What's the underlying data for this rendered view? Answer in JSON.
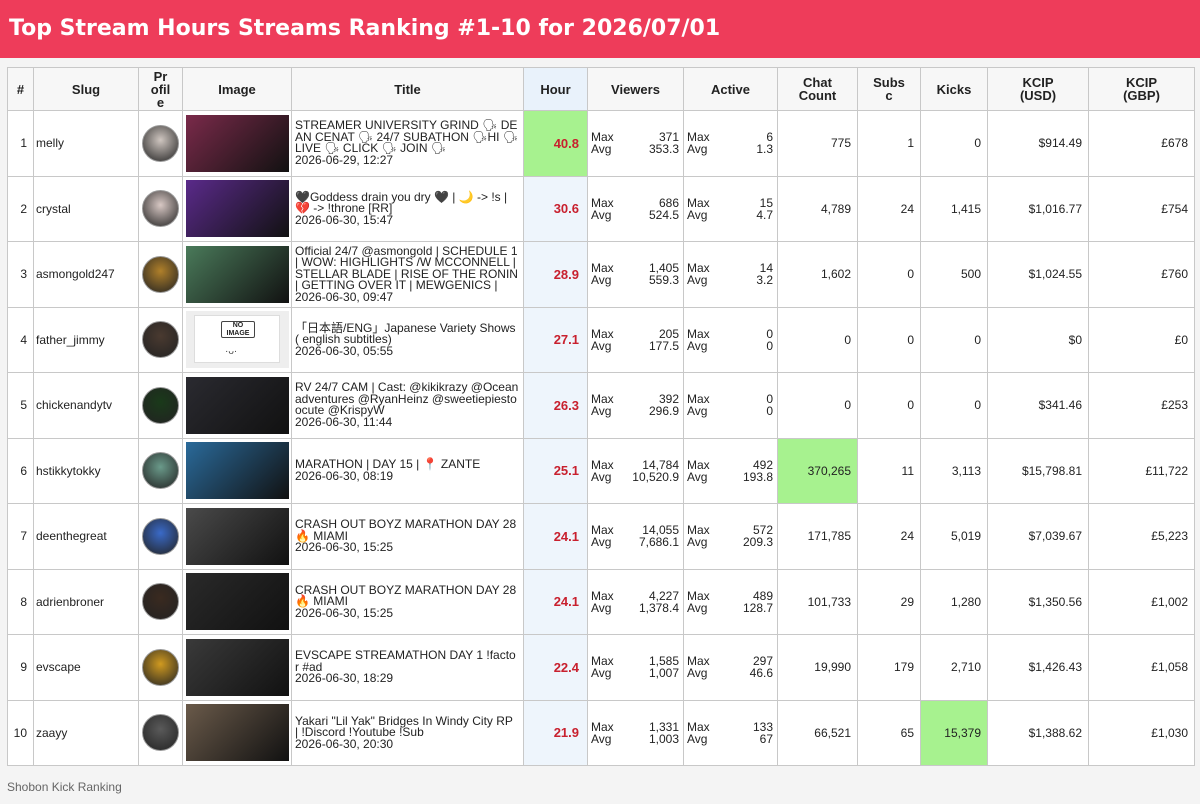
{
  "page": {
    "title": "Top Stream Hours Streams Ranking #1-10 for 2026/07/01",
    "footer": "Shobon Kick Ranking"
  },
  "colors": {
    "banner": "#ee3c5a",
    "highlight": "#a7f28f",
    "hour_text": "#c8202e",
    "hour_bg": "#eef5fc"
  },
  "headers": {
    "rank": "#",
    "slug": "Slug",
    "profile": "Pr\nofil\ne",
    "image": "Image",
    "title": "Title",
    "hour": "Hour",
    "viewers": "Viewers",
    "active": "Active",
    "chat": "Chat\nCount",
    "subs": "Subs\nc",
    "kicks": "Kicks",
    "kcip_usd": "KCIP\n(USD)",
    "kcip_gbp": "KCIP\n(GBP)"
  },
  "labels": {
    "max": "Max",
    "avg": "Avg",
    "no_image": "NO\nIMAGE",
    "no_image_face": "·ᴗ·"
  },
  "rows": [
    {
      "rank": "1",
      "slug": "melly",
      "title": "STREAMER UNIVERSITY GRIND 🗣 DEAN CENAT 🗣 24/7 SUBATHON 🗣HI 🗣 LIVE 🗣 CLICK 🗣 JOIN 🗣",
      "date": "2026-06-29, 12:27",
      "hour": "40.8",
      "v_max": "371",
      "v_avg": "353.3",
      "a_max": "6",
      "a_avg": "1.3",
      "chat": "775",
      "subs": "1",
      "kicks": "0",
      "usd": "$914.49",
      "gbp": "£678",
      "avatar": "#cfc6c0",
      "thumb": "#7a2a4a"
    },
    {
      "rank": "2",
      "slug": "crystal",
      "title": "🖤Goddess drain you dry 🖤 | 🌙 -> !s | 💔 -> !throne [RR]",
      "date": "2026-06-30, 15:47",
      "hour": "30.6",
      "v_max": "686",
      "v_avg": "524.5",
      "a_max": "15",
      "a_avg": "4.7",
      "chat": "4,789",
      "subs": "24",
      "kicks": "1,415",
      "usd": "$1,016.77",
      "gbp": "£754",
      "avatar": "#d8c8c4",
      "thumb": "#5a2a8a"
    },
    {
      "rank": "3",
      "slug": "asmongold247",
      "title": "Official 24/7 @asmongold | SCHEDULE 1 | WOW: HIGHLIGHTS /W MCCONNELL | STELLAR BLADE | RISE OF THE RONIN | GETTING OVER IT | MEWGENICS |",
      "date": "2026-06-30, 09:47",
      "hour": "28.9",
      "v_max": "1,405",
      "v_avg": "559.3",
      "a_max": "14",
      "a_avg": "3.2",
      "chat": "1,602",
      "subs": "0",
      "kicks": "500",
      "usd": "$1,024.55",
      "gbp": "£760",
      "avatar": "#b0802a",
      "thumb": "#4a7a5a"
    },
    {
      "rank": "4",
      "slug": "father_jimmy",
      "title": "「日本語/ENG」Japanese Variety Shows ( english subtitles)",
      "date": "2026-06-30, 05:55",
      "hour": "27.1",
      "v_max": "205",
      "v_avg": "177.5",
      "a_max": "0",
      "a_avg": "0",
      "chat": "0",
      "subs": "0",
      "kicks": "0",
      "usd": "$0",
      "gbp": "£0",
      "avatar": "#4a3a30",
      "thumb": "noimage"
    },
    {
      "rank": "5",
      "slug": "chickenandytv",
      "title": "RV 24/7 CAM | Cast: @kikikrazy @Oceanadventures @RyanHeinz @sweetiepiestoocute @KrispyW",
      "date": "2026-06-30, 11:44",
      "hour": "26.3",
      "v_max": "392",
      "v_avg": "296.9",
      "a_max": "0",
      "a_avg": "0",
      "chat": "0",
      "subs": "0",
      "kicks": "0",
      "usd": "$341.46",
      "gbp": "£253",
      "avatar": "#1a3a1a",
      "thumb": "#2a2a30"
    },
    {
      "rank": "6",
      "slug": "hstikkytokky",
      "title": "MARATHON | DAY 15 | 📍 ZANTE",
      "date": "2026-06-30, 08:19",
      "hour": "25.1",
      "v_max": "14,784",
      "v_avg": "10,520.9",
      "a_max": "492",
      "a_avg": "193.8",
      "chat": "370,265",
      "subs": "11",
      "kicks": "3,113",
      "usd": "$15,798.81",
      "gbp": "£11,722",
      "avatar": "#6a9a8a",
      "thumb": "#2a6a9a",
      "hl_chat": true
    },
    {
      "rank": "7",
      "slug": "deenthegreat",
      "title": "CRASH OUT BOYZ MARATHON DAY 28 🔥 MIAMI",
      "date": "2026-06-30, 15:25",
      "hour": "24.1",
      "v_max": "14,055",
      "v_avg": "7,686.1",
      "a_max": "572",
      "a_avg": "209.3",
      "chat": "171,785",
      "subs": "24",
      "kicks": "5,019",
      "usd": "$7,039.67",
      "gbp": "£5,223",
      "avatar": "#3a6ac8",
      "thumb": "#4a4a4a"
    },
    {
      "rank": "8",
      "slug": "adrienbroner",
      "title": "CRASH OUT BOYZ MARATHON DAY 28 🔥 MIAMI",
      "date": "2026-06-30, 15:25",
      "hour": "24.1",
      "v_max": "4,227",
      "v_avg": "1,378.4",
      "a_max": "489",
      "a_avg": "128.7",
      "chat": "101,733",
      "subs": "29",
      "kicks": "1,280",
      "usd": "$1,350.56",
      "gbp": "£1,002",
      "avatar": "#3a2a20",
      "thumb": "#2a2a2a"
    },
    {
      "rank": "9",
      "slug": "evscape",
      "title": "EVSCAPE STREAMATHON DAY 1 !factor #ad",
      "date": "2026-06-30, 18:29",
      "hour": "22.4",
      "v_max": "1,585",
      "v_avg": "1,007",
      "a_max": "297",
      "a_avg": "46.6",
      "chat": "19,990",
      "subs": "179",
      "kicks": "2,710",
      "usd": "$1,426.43",
      "gbp": "£1,058",
      "avatar": "#d09a20",
      "thumb": "#3a3a3a"
    },
    {
      "rank": "10",
      "slug": "zaayy",
      "title": "Yakari \"Lil Yak\" Bridges In Windy City RP | !Discord !Youtube !Sub",
      "date": "2026-06-30, 20:30",
      "hour": "21.9",
      "v_max": "1,331",
      "v_avg": "1,003",
      "a_max": "133",
      "a_avg": "67",
      "chat": "66,521",
      "subs": "65",
      "kicks": "15,379",
      "usd": "$1,388.62",
      "gbp": "£1,030",
      "avatar": "#5a5a5a",
      "thumb": "#6a5a4a",
      "hl_kicks": true
    }
  ]
}
